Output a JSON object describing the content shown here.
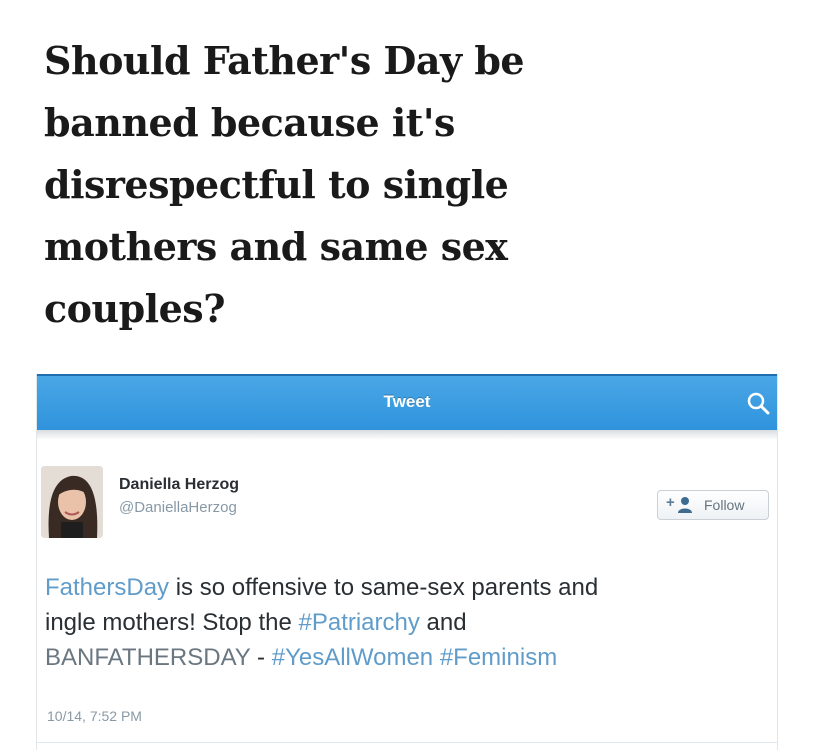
{
  "headline": {
    "line1": "Should Father's Day be",
    "line2": "banned because it's",
    "line3": "disrespectful to single",
    "line4": "mothers and same sex",
    "line5": "couples?"
  },
  "top_bar": {
    "title": "Tweet",
    "search_icon": "search-icon",
    "color": "#2f93dc"
  },
  "user": {
    "name": "Daniella Herzog",
    "handle": "@DaniellaHerzog",
    "avatar_icon": "avatar"
  },
  "follow_button": {
    "plus": "+",
    "label": "Follow"
  },
  "tweet": {
    "line1_tag": "FathersDay",
    "line1_rest": " is so offensive to same-sex parents and",
    "line2_start": "ingle mothers! Stop the ",
    "line2_tag": "#Patriarchy",
    "line2_end": " and",
    "line3_start": "BANFATHERSDAY",
    "line3_sep": " - ",
    "line3_tag1": "#YesAllWomen",
    "line3_space": " ",
    "line3_tag2": "#Feminism",
    "timestamp": "10/14, 7:52 PM",
    "link_color": "#2b7bb9"
  }
}
